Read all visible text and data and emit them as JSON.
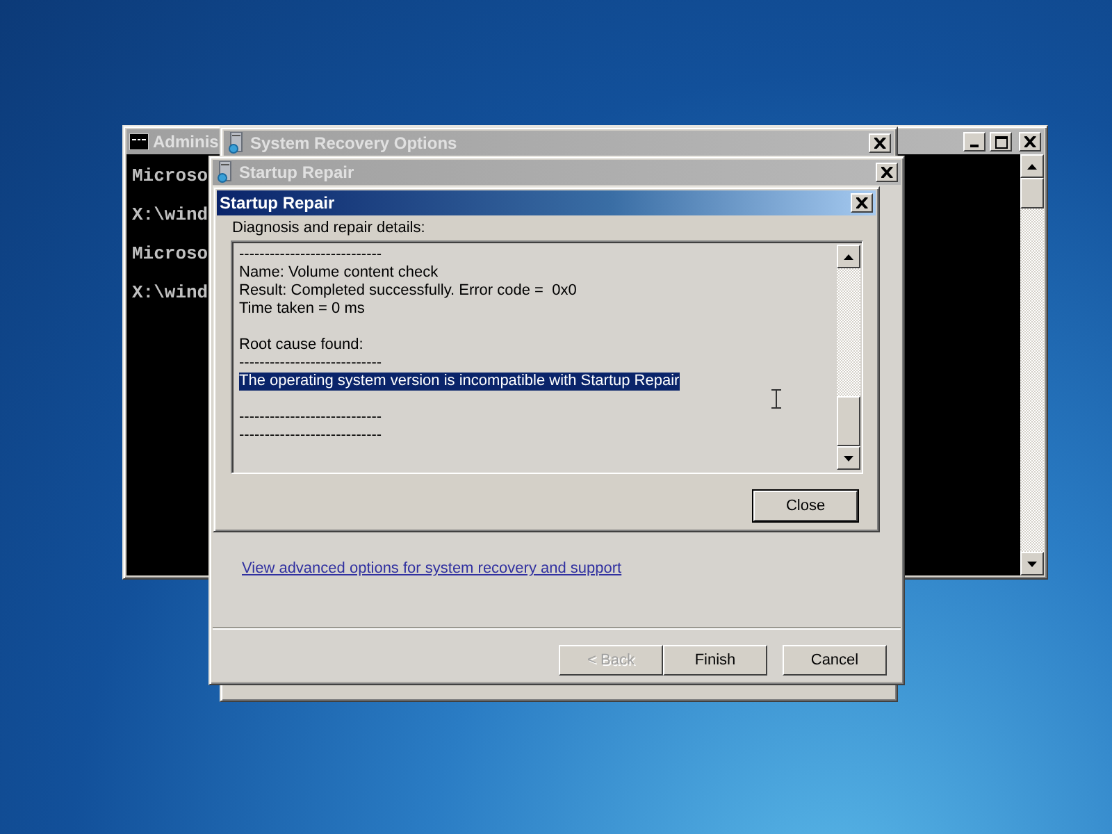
{
  "console_window": {
    "title": "Adminis",
    "lines": [
      "Microso",
      "X:\\wind",
      "Microso",
      "X:\\wind"
    ]
  },
  "recovery_window": {
    "title": "System Recovery Options"
  },
  "wizard_window": {
    "title": "Startup Repair",
    "link": "View advanced options for system recovery and support",
    "buttons": [
      {
        "label": "< Back",
        "disabled": true
      },
      {
        "label": "Finish",
        "disabled": false
      },
      {
        "label": "Cancel",
        "disabled": false
      }
    ]
  },
  "details_dialog": {
    "title": "Startup Repair",
    "label": "Diagnosis and repair details:",
    "close_button": "Close",
    "paragraphs": [
      {
        "lines": [
          {
            "text": "----------------------------",
            "selected": false
          },
          {
            "text": "Name: Volume content check",
            "selected": false
          },
          {
            "text": "Result: Completed successfully. Error code =  0x0",
            "selected": false
          },
          {
            "text": "Time taken = 0 ms",
            "selected": false
          }
        ]
      },
      {
        "lines": [
          {
            "text": "Root cause found:",
            "selected": false
          },
          {
            "text": "----------------------------",
            "selected": false
          },
          {
            "text": "The operating system version is incompatible with Startup Repair",
            "selected": true
          }
        ]
      },
      {
        "lines": [
          {
            "text": "----------------------------",
            "selected": false
          },
          {
            "text": "----------------------------",
            "selected": false
          }
        ]
      }
    ]
  }
}
